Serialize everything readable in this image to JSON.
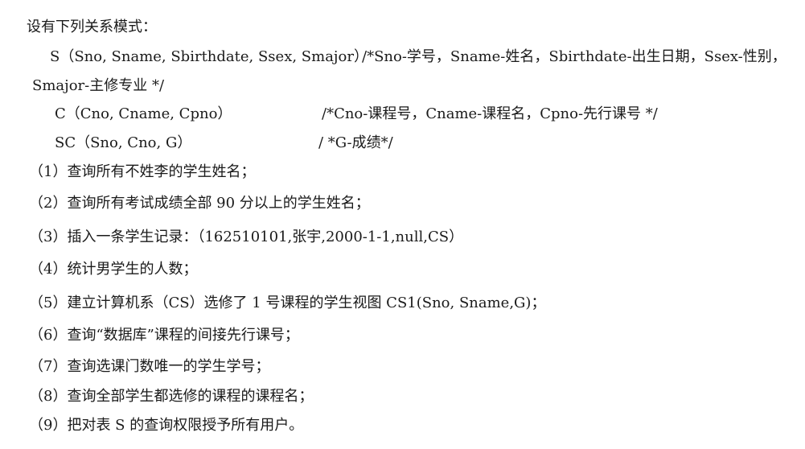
{
  "intro": "设有下列关系模式：",
  "schemas": {
    "s": {
      "definition": "S（Sno, Sname, Sbirthdate, Ssex, Smajor）",
      "comment": "/*Sno-学号，Sname-姓名，Sbirthdate-出生日期，Ssex-性别，",
      "comment_cont": "Smajor-主修专业  */"
    },
    "c": {
      "definition": "C（Cno, Cname, Cpno）",
      "comment": "/*Cno-课程号，Cname-课程名，Cpno-先行课号  */"
    },
    "sc": {
      "definition": "SC（Sno, Cno, G）",
      "comment": "/ *G-成绩*/"
    }
  },
  "questions": [
    "（1）查询所有不姓李的学生姓名；",
    "（2）查询所有考试成绩全部 90 分以上的学生姓名；",
    "（3）插入一条学生记录：（162510101,张宇,2000-1-1,null,CS）",
    "（4）统计男学生的人数；",
    "（5）建立计算机系（CS）选修了 1 号课程的学生视图 CS1(Sno, Sname,G)；",
    "（6）查询“数据库”课程的间接先行课号；",
    "（7）查询选课门数唯一的学生学号；",
    "（8）查询全部学生都选修的课程的课程名；",
    "（9）把对表 S 的查询权限授予所有用户。"
  ]
}
